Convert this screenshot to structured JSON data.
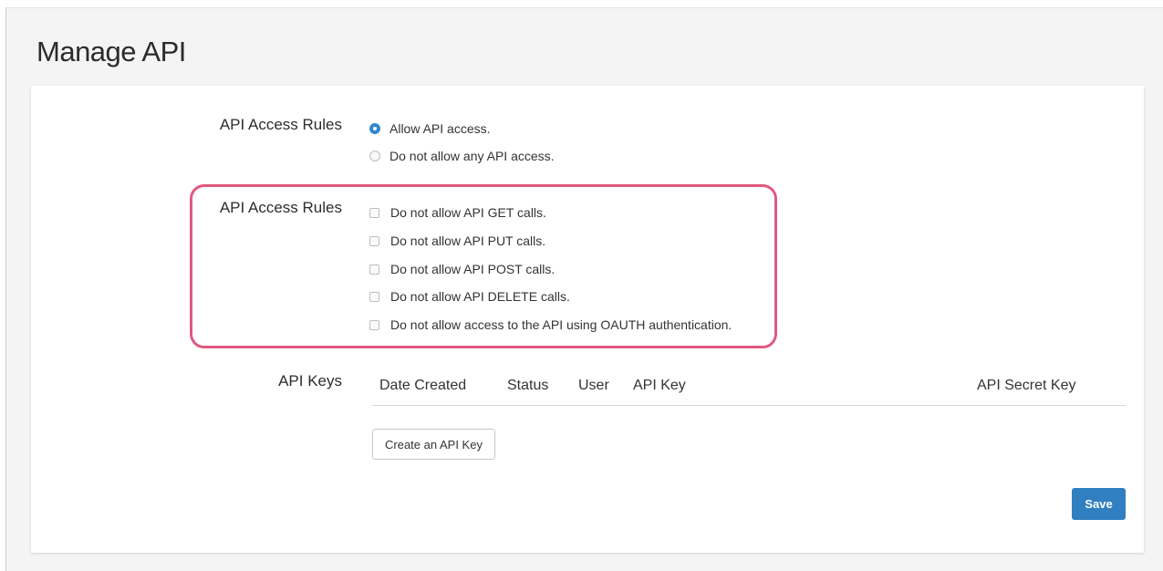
{
  "page": {
    "title": "Manage API"
  },
  "access": {
    "label": "API Access Rules",
    "options": [
      {
        "label": "Allow API access.",
        "checked": true
      },
      {
        "label": "Do not allow any API access.",
        "checked": false
      }
    ]
  },
  "restrictions": {
    "label": "API Access Rules",
    "options": [
      {
        "label": "Do not allow API GET calls.",
        "checked": false
      },
      {
        "label": "Do not allow API PUT calls.",
        "checked": false
      },
      {
        "label": "Do not allow API POST calls.",
        "checked": false
      },
      {
        "label": "Do not allow API DELETE calls.",
        "checked": false
      },
      {
        "label": "Do not allow access to the API using OAUTH authentication.",
        "checked": false
      }
    ]
  },
  "keys": {
    "label": "API Keys",
    "columns": [
      "Date Created",
      "Status",
      "User",
      "API Key",
      "API Secret Key"
    ],
    "rows": [],
    "create_label": "Create an API Key"
  },
  "actions": {
    "save_label": "Save"
  },
  "colors": {
    "accent": "#2f7fc1",
    "highlight": "#e0597f"
  }
}
